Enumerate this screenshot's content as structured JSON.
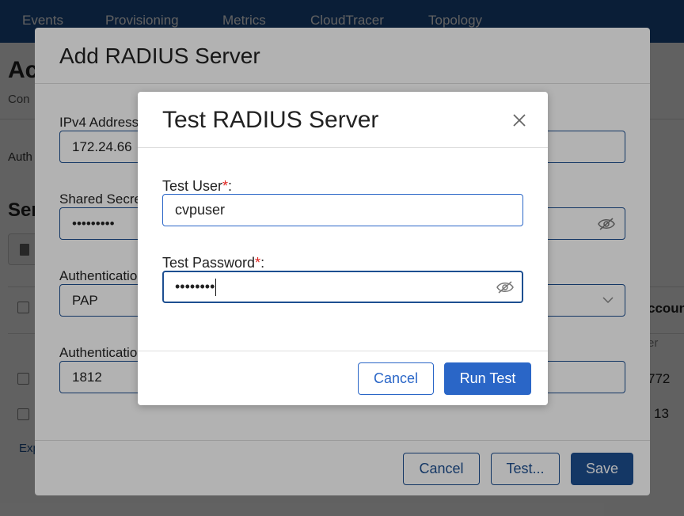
{
  "topnav": {
    "items": [
      "Events",
      "Provisioning",
      "Metrics",
      "CloudTracer",
      "Topology"
    ]
  },
  "background_page": {
    "title_fragment": "Ac",
    "subtitle_fragment": "Con",
    "auth_fragment": "Auth",
    "section_fragment": "Ser",
    "right_col_header_fragment": "ccount",
    "right_col_sub_fragment": "er",
    "row_values": [
      "772",
      "13"
    ],
    "export_fragment": "Exp"
  },
  "add_modal": {
    "title": "Add RADIUS Server",
    "fields": {
      "ipv4_label": "IPv4 Address",
      "ipv4_value": "172.24.66",
      "shared_secret_label": "Shared Secre",
      "shared_secret_value": "•••••••••",
      "auth_protocol_label": "Authenticatio",
      "auth_protocol_value": "PAP",
      "auth_port_label": "Authenticatio",
      "auth_port_value": "1812"
    },
    "buttons": {
      "cancel": "Cancel",
      "test": "Test...",
      "save": "Save"
    }
  },
  "test_modal": {
    "title": "Test RADIUS Server",
    "user_label": "Test User",
    "user_value": "cvpuser",
    "password_label": "Test Password",
    "password_value": "••••••••",
    "required_mark": "*",
    "label_suffix": ":",
    "buttons": {
      "cancel": "Cancel",
      "run": "Run Test"
    }
  },
  "colors": {
    "nav_bg": "#1d4f91",
    "primary": "#2a66c7",
    "required": "#e0241f"
  },
  "icons": [
    "close-icon",
    "eye-slash-icon",
    "chevron-down-icon",
    "trash-icon"
  ]
}
